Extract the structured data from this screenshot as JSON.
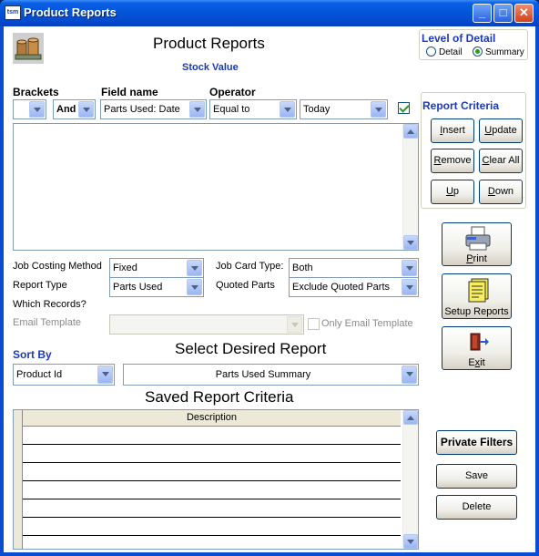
{
  "window": {
    "icon_text": "tsm",
    "title": "Product Reports",
    "controls": {
      "minimize": "_",
      "maximize": "□",
      "close": "✕"
    }
  },
  "header": {
    "title": "Product Reports",
    "subtitle": "Stock Value"
  },
  "level_of_detail": {
    "label": "Level of Detail",
    "options": [
      "Detail",
      "Summary"
    ],
    "selected": "Summary"
  },
  "criteria_row": {
    "labels": {
      "brackets": "Brackets",
      "field_name": "Field name",
      "operator": "Operator"
    },
    "brackets_value": "",
    "and_value": "And",
    "field_value": "Parts Used: Date",
    "operator_value": "Equal to",
    "value_value": "Today",
    "enabled_checked": true
  },
  "report_criteria": {
    "label": "Report Criteria",
    "buttons": {
      "insert": {
        "u": "I",
        "rest": "nsert"
      },
      "update": {
        "u": "U",
        "rest": "pdate"
      },
      "remove": {
        "u": "R",
        "rest": "emove"
      },
      "clear_all": {
        "u": "C",
        "rest": "lear All"
      },
      "up": {
        "u": "U",
        "rest": "p"
      },
      "down": {
        "u": "D",
        "rest": "own"
      }
    }
  },
  "actions": {
    "print": {
      "u": "P",
      "rest": "rint"
    },
    "setup_reports": "Setup Reports",
    "exit": {
      "pre": "E",
      "u": "x",
      "rest": "it"
    }
  },
  "options": {
    "job_costing_label": "Job Costing Method",
    "job_costing_value": "Fixed",
    "report_type_label": "Report Type",
    "report_type_value": "Parts Used",
    "which_records_label": "Which Records?",
    "job_card_type_label": "Job Card Type:",
    "job_card_type_value": "Both",
    "quoted_parts_label": "Quoted Parts",
    "quoted_parts_value": "Exclude Quoted Parts",
    "email_template_label": "Email Template",
    "email_template_value": "",
    "only_email_template_label": "Only Email Template"
  },
  "sort": {
    "label": "Sort By",
    "value": "Product Id"
  },
  "report_select": {
    "heading": "Select Desired Report",
    "value": "Parts Used Summary"
  },
  "saved": {
    "heading": "Saved Report Criteria",
    "column": "Description",
    "rows": [
      "",
      "",
      "",
      "",
      "",
      "",
      ""
    ]
  },
  "side_buttons": {
    "private_filters": "Private Filters",
    "save": "Save",
    "delete": "Delete"
  }
}
